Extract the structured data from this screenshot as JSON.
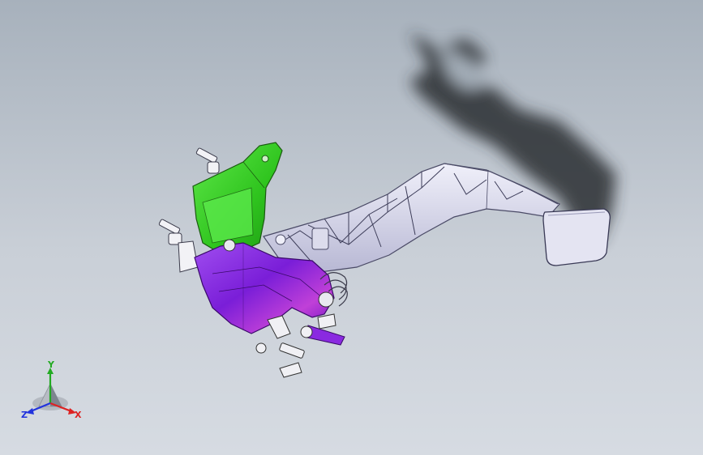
{
  "viewport": {
    "background_top": "#a7b1bc",
    "background_bottom": "#d6dbe2"
  },
  "model": {
    "parts": [
      {
        "name": "mounting-bracket",
        "color": "#33cc22"
      },
      {
        "name": "pedal-box-housing",
        "color": "#8a22dd"
      },
      {
        "name": "pedal-arm",
        "color": "#d8d8ec"
      },
      {
        "name": "pedal-pad",
        "color": "#e2e2f0"
      }
    ],
    "shadow_color": "#2a2d33"
  },
  "triad": {
    "y_label": "Y",
    "x_label": "X",
    "z_label": "Z",
    "y_color": "#22aa22",
    "x_color": "#dd2222",
    "z_color": "#2233dd"
  }
}
